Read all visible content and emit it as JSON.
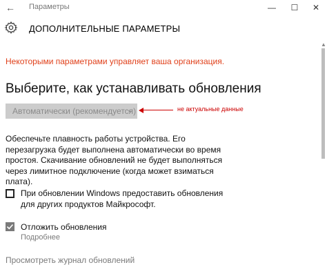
{
  "window": {
    "back_glyph": "←",
    "title": "Параметры",
    "minimize_glyph": "—",
    "maximize_glyph": "☐",
    "close_glyph": "✕"
  },
  "header": {
    "title": "ДОПОЛНИТЕЛЬНЫЕ ПАРАМЕТРЫ",
    "icon": "gear-icon"
  },
  "org_warning": "Некоторыми параметрами управляет ваша организация.",
  "section_heading": "Выберите, как устанавливать обновления",
  "dropdown": {
    "selected": "Автоматически (рекомендуется)",
    "chevron": "⌄",
    "disabled": true
  },
  "annotation": "не актуальные данные",
  "description": "Обеспечьте плавность работы устройства. Его перезагрузка будет выполнена автоматически во время простоя. Скачивание обновлений не будет выполняться через лимитное подключение (когда может взиматься плата).",
  "checkbox1": {
    "label": "При обновлении Windows предоставить обновления для других продуктов Майкрософт.",
    "checked": false
  },
  "checkbox2": {
    "label": "Отложить обновления",
    "checked": true
  },
  "more_link": "Подробнее",
  "history_link": "Просмотреть журнал обновлений",
  "scrollbar": {
    "up_glyph": "▲"
  },
  "colors": {
    "warning": "#e0401a",
    "annotation": "#cc0000",
    "disabled": "#cccccc"
  }
}
